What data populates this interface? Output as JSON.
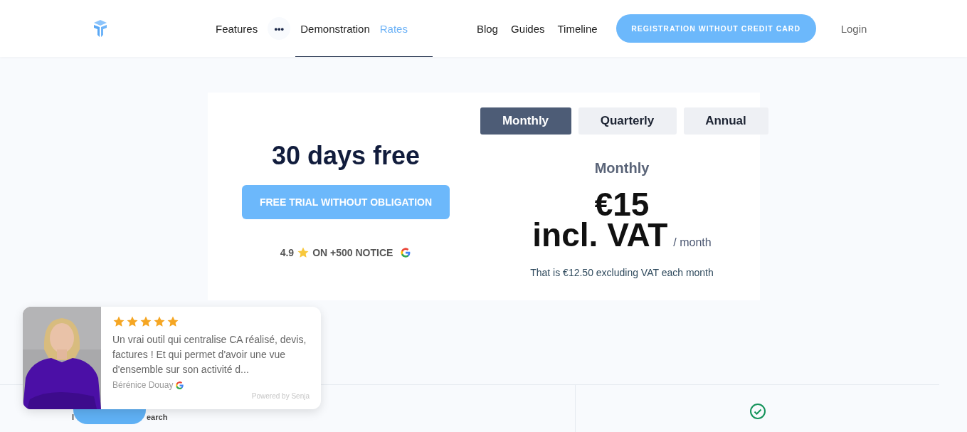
{
  "header": {
    "nav": [
      {
        "label": "Features",
        "kind": "link",
        "selected": false
      },
      {
        "label": "•••",
        "kind": "more",
        "selected": false
      },
      {
        "label": "Demonstration",
        "kind": "link",
        "selected": false
      },
      {
        "label": "Rates",
        "kind": "link",
        "selected": true
      }
    ],
    "nav_right": [
      {
        "label": "Blog"
      },
      {
        "label": "Guides"
      },
      {
        "label": "Timeline"
      }
    ],
    "cta": "REGISTRATION WITHOUT CREDIT CARD",
    "login": "Login"
  },
  "pricing": {
    "title": "30 days free",
    "trial_button": "FREE TRIAL WITHOUT OBLIGATION",
    "rating": {
      "score": "4.9",
      "text": "ON +500 NOTICE"
    },
    "tabs": [
      {
        "label": "Monthly",
        "selected": true
      },
      {
        "label": "Quarterly",
        "selected": false
      },
      {
        "label": "Annual",
        "selected": false
      }
    ],
    "period": "Monthly",
    "price": "€15",
    "price_suffix": "incl. VAT",
    "per": "/ month",
    "note": "That is €12.50 excluding VAT each month"
  },
  "review": {
    "stars": 5,
    "text": "Un vrai outil qui centralise CA réalisé, devis, factures ! Et qui permet d'avoir une vue d'ensemble sur son activité d...",
    "author": "Bérénice Douay",
    "powered": "Powered by Senja"
  },
  "hidden_fragments": [
    "I",
    "earch"
  ]
}
